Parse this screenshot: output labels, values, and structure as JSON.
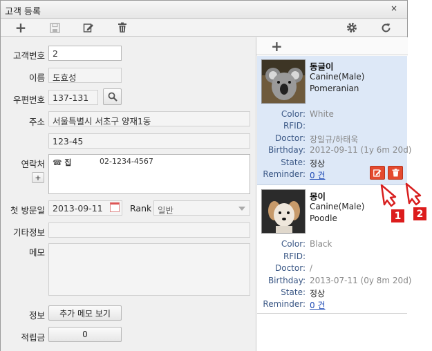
{
  "window": {
    "title": "고객 등록",
    "close": "×"
  },
  "toolbar": {
    "add": "+",
    "save": "save-icon",
    "edit": "edit-icon",
    "delete": "trash-icon",
    "settings": "gear-icon",
    "refresh": "refresh-icon"
  },
  "form": {
    "customer_no_label": "고객번호",
    "customer_no": "2",
    "name_label": "이름",
    "name": "도효성",
    "zip_label": "우편번호",
    "zip": "137-131",
    "address_label": "주소",
    "address1": "서울특별시 서초구 양재1동",
    "address2": "123-45",
    "contact_label": "연락처",
    "contact_type": "집",
    "contact_value": "02-1234-4567",
    "contact_add": "+",
    "first_visit_label": "첫 방문일",
    "first_visit": "2013-09-11",
    "rank_label": "Rank",
    "rank": "일반",
    "other_label": "기타정보",
    "other": "",
    "memo_label": "메모",
    "memo": "",
    "info_label": "정보",
    "memo_button": "추가 메모 보기",
    "points_label": "적립금",
    "points": "0"
  },
  "pets_toolbar": {
    "add": "+"
  },
  "pets": [
    {
      "name": "동글이",
      "species": "Canine(Male)",
      "breed": "Pomeranian",
      "color_label": "Color:",
      "color": "White",
      "rfid_label": "RFID:",
      "rfid": "",
      "doctor_label": "Doctor:",
      "doctor": "장일규/하태욱",
      "birthday_label": "Birthday:",
      "birthday": "2012-09-11 (1y 6m 20d)",
      "state_label": "State:",
      "state": "정상",
      "reminder_label": "Reminder:",
      "reminder": "0 건"
    },
    {
      "name": "몽이",
      "species": "Canine(Male)",
      "breed": "Poodle",
      "color_label": "Color:",
      "color": "Black",
      "rfid_label": "RFID:",
      "rfid": "",
      "doctor_label": "Doctor:",
      "doctor": "/",
      "birthday_label": "Birthday:",
      "birthday": "2013-07-11 (0y 8m 20d)",
      "state_label": "State:",
      "state": "정상",
      "reminder_label": "Reminder:",
      "reminder": "0 건"
    }
  ],
  "callouts": {
    "one": "1",
    "two": "2"
  },
  "colors": {
    "accent": "#e44a2f",
    "selected": "#dde8f7",
    "badge": "#dc1c1c",
    "link": "#1f4bb5"
  }
}
